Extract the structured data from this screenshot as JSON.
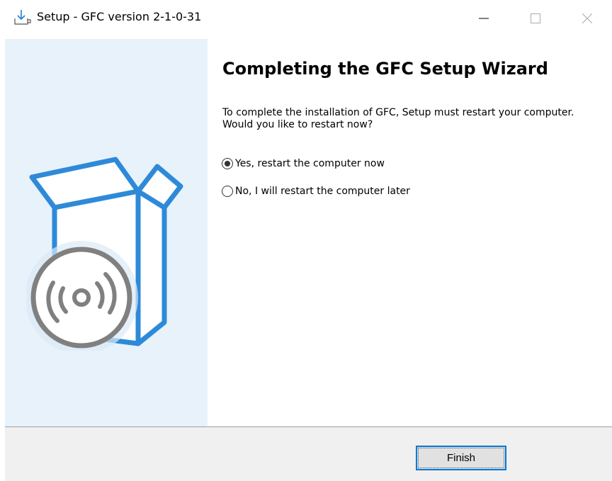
{
  "window": {
    "title": "Setup - GFC version 2-1-0-31",
    "icon": "download-install-icon",
    "controls": [
      "minimize-icon",
      "maximize-icon",
      "close-icon"
    ]
  },
  "side_panel": {
    "icon": "box-with-disc-icon",
    "colors": {
      "panel_bg": "#e8f2fb",
      "box": "#2e8ad8",
      "disc": "#808080"
    }
  },
  "content": {
    "heading": "Completing the GFC Setup Wizard",
    "description": "To complete the installation of GFC, Setup must restart your computer. Would you like to restart now?",
    "options": [
      {
        "label": "Yes, restart the computer now",
        "selected": true
      },
      {
        "label": "No, I will restart the computer later",
        "selected": false
      }
    ]
  },
  "footer": {
    "finish_label": "Finish",
    "accent": "#0078d7"
  }
}
